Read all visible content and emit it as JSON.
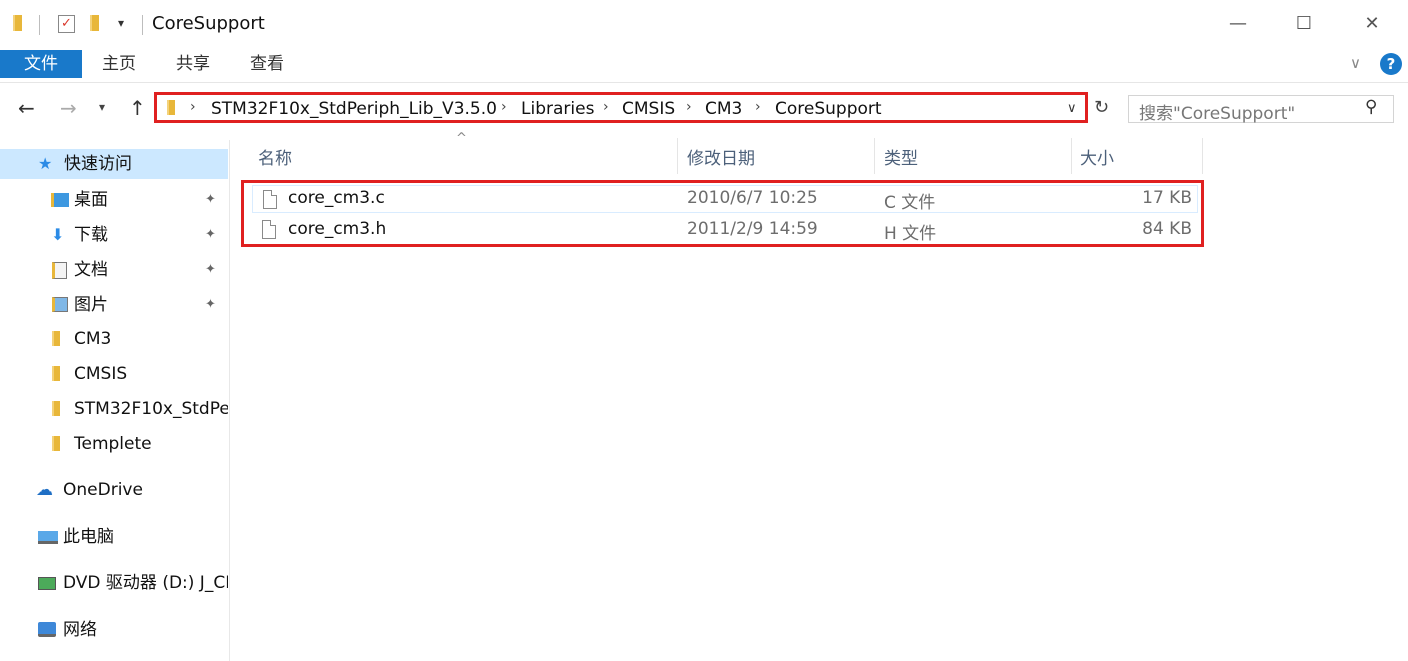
{
  "window": {
    "title": "CoreSupport",
    "minimize": "—",
    "maximize": "☐",
    "close": "✕"
  },
  "ribbon": {
    "tabs": [
      "文件",
      "主页",
      "共享",
      "查看"
    ]
  },
  "address": {
    "crumbs": [
      "STM32F10x_StdPeriph_Lib_V3.5.0",
      "Libraries",
      "CMSIS",
      "CM3",
      "CoreSupport"
    ],
    "search_placeholder": "搜索\"CoreSupport\""
  },
  "nav": {
    "quick_access": "快速访问",
    "items": [
      "桌面",
      "下载",
      "文档",
      "图片",
      "CM3",
      "CMSIS",
      "STM32F10x_StdPe",
      "Templete"
    ],
    "onedrive": "OneDrive",
    "this_pc": "此电脑",
    "dvd": "DVD 驱动器 (D:) J_CI",
    "network": "网络"
  },
  "columns": {
    "name": "名称",
    "modified": "修改日期",
    "type": "类型",
    "size": "大小"
  },
  "files": [
    {
      "name": "core_cm3.c",
      "modified": "2010/6/7 10:25",
      "type": "C 文件",
      "size": "17 KB"
    },
    {
      "name": "core_cm3.h",
      "modified": "2011/2/9 14:59",
      "type": "H 文件",
      "size": "84 KB"
    }
  ],
  "colors": {
    "accent": "#1979ca",
    "highlight_border": "#e02020",
    "folder": "#e8b73a"
  }
}
